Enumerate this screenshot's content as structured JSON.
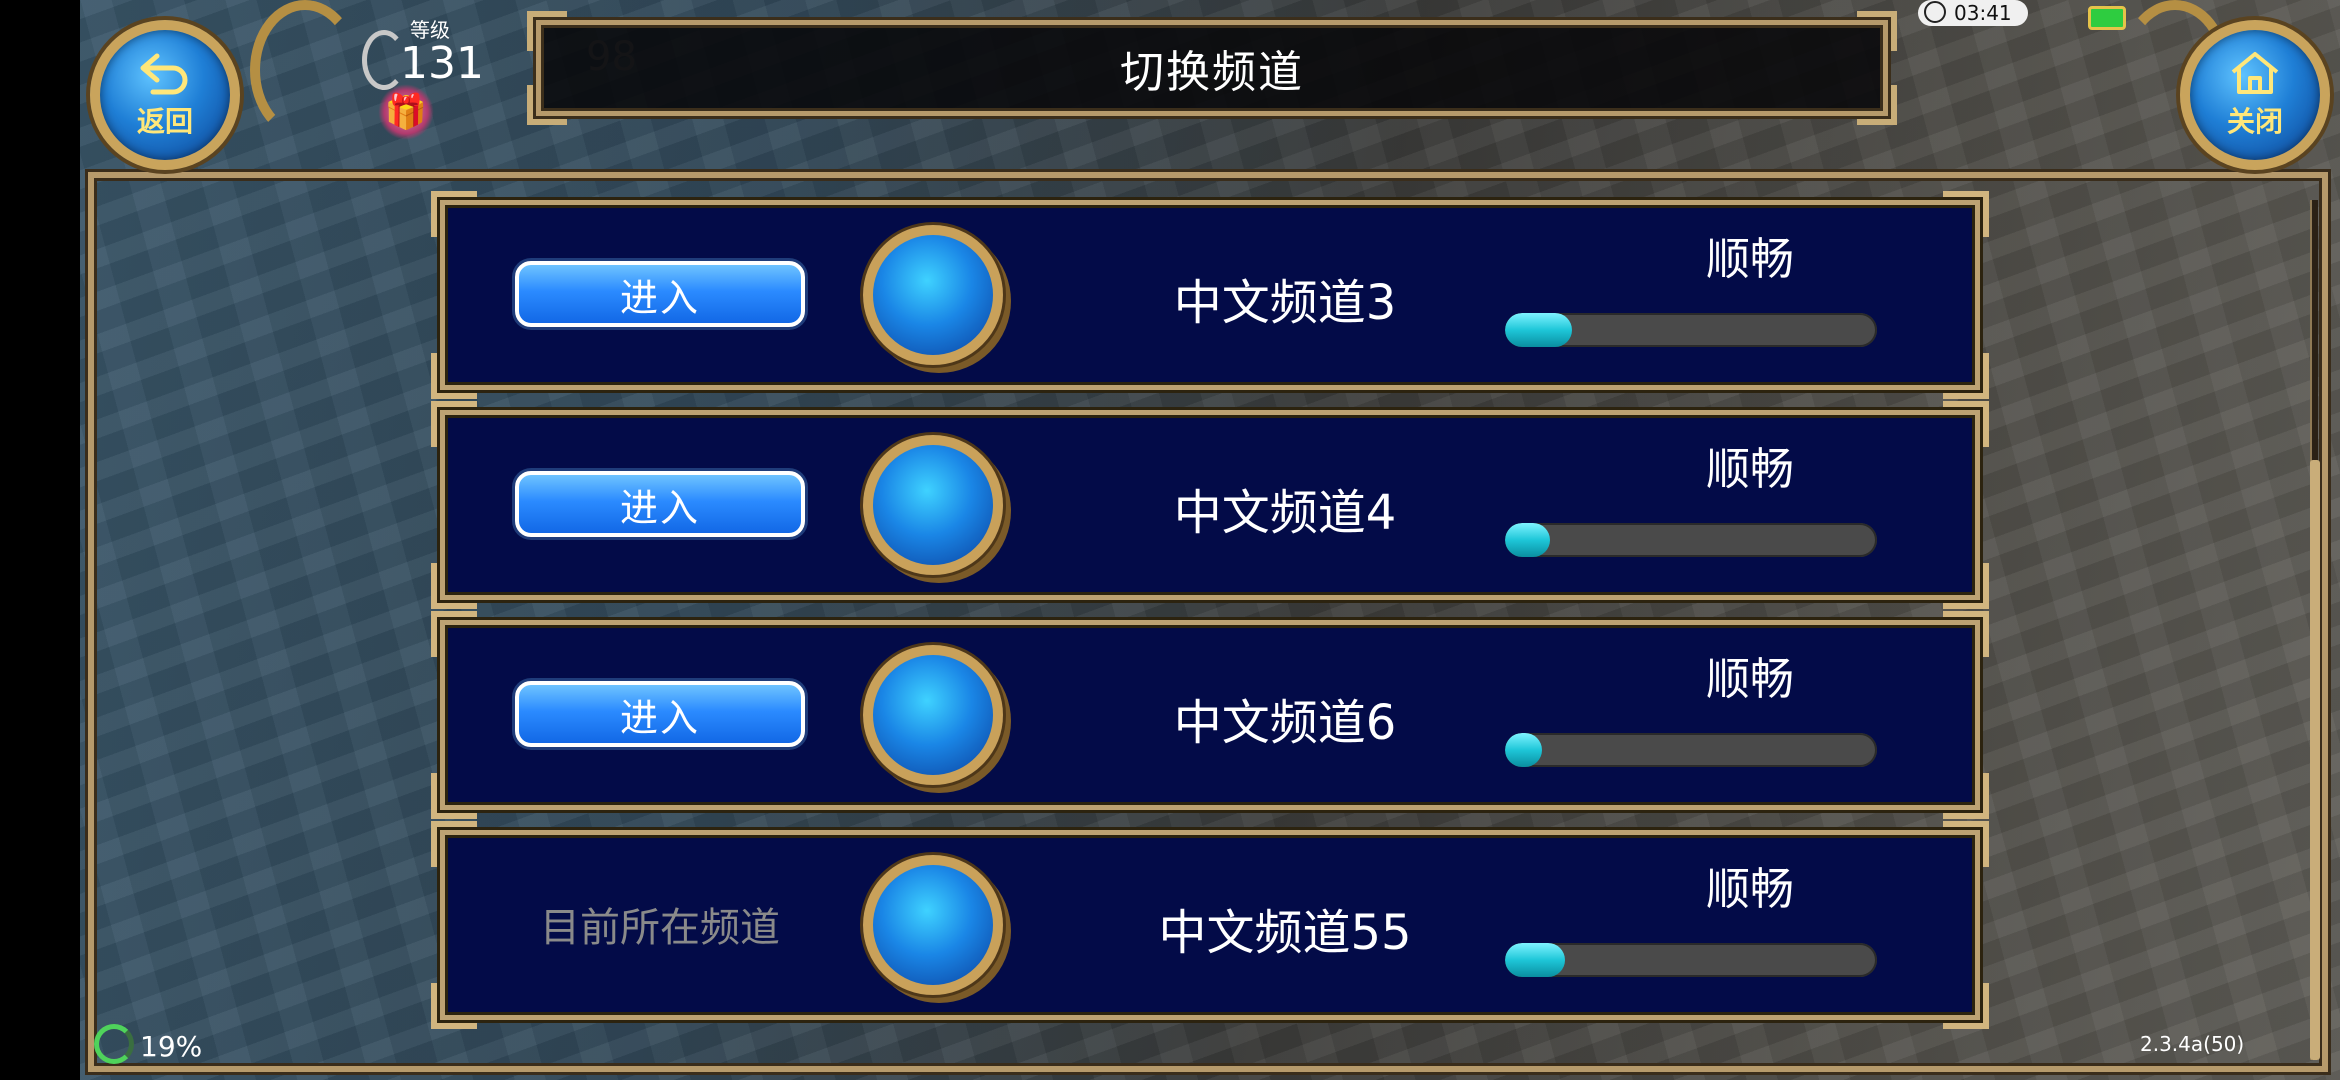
{
  "header": {
    "title": "切换频道",
    "back_label": "返回",
    "close_label": "关闭",
    "level_label": "等级",
    "level_value": "131",
    "secondary_value": "98",
    "time": "03:41"
  },
  "channels": [
    {
      "action_label": "进入",
      "name": "中文频道3",
      "status": "顺畅",
      "load": 0.18,
      "is_current": false
    },
    {
      "action_label": "进入",
      "name": "中文频道4",
      "status": "顺畅",
      "load": 0.12,
      "is_current": false
    },
    {
      "action_label": "进入",
      "name": "中文频道6",
      "status": "顺畅",
      "load": 0.1,
      "is_current": false
    },
    {
      "action_label": "目前所在频道",
      "name": "中文频道55",
      "status": "顺畅",
      "load": 0.16,
      "is_current": true
    }
  ],
  "footer": {
    "percent": "19%",
    "version": "2.3.4a(50)"
  },
  "colors": {
    "row_bg": "#030b48",
    "gold_frame": "#bda273",
    "enter_button": "#2b8bff",
    "bar_fill": "#1ec6d8"
  },
  "icons": [
    "back-arrow-icon",
    "home-icon",
    "gift-icon",
    "clock-icon",
    "battery-icon",
    "orb-icon"
  ]
}
